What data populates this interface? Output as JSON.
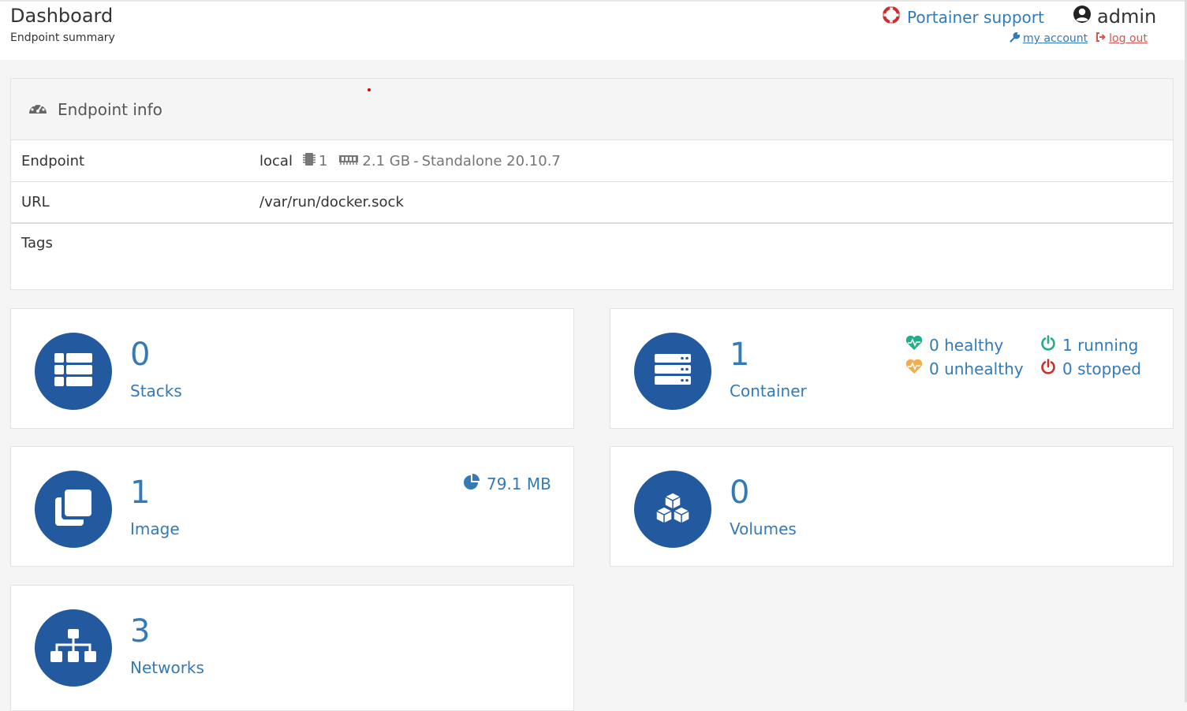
{
  "header": {
    "title": "Dashboard",
    "subtitle": "Endpoint summary",
    "support_label": "Portainer support",
    "username": "admin",
    "my_account": "my account",
    "log_out": "log out"
  },
  "endpoint_info": {
    "heading": "Endpoint info",
    "rows": [
      {
        "label": "Endpoint",
        "value": "local",
        "cpu": "1",
        "memory": "2.1 GB",
        "separator": "-",
        "mode": "Standalone 20.10.7"
      },
      {
        "label": "URL",
        "value": "/var/run/docker.sock"
      },
      {
        "label": "Tags",
        "value": ""
      }
    ]
  },
  "cards": {
    "stacks": {
      "count": "0",
      "label": "Stacks"
    },
    "containers": {
      "count": "1",
      "label": "Container",
      "healthy": "0 healthy",
      "unhealthy": "0 unhealthy",
      "running": "1 running",
      "stopped": "0 stopped"
    },
    "images": {
      "count": "1",
      "label": "Image",
      "size": "79.1 MB"
    },
    "volumes": {
      "count": "0",
      "label": "Volumes"
    },
    "networks": {
      "count": "3",
      "label": "Networks"
    }
  },
  "colors": {
    "accent": "#337ab7",
    "icon_circle": "#23599f",
    "healthy": "#23ae89",
    "unhealthy": "#f0ad4e",
    "stopped": "#c9302c",
    "danger": "#d9534f"
  },
  "icons": [
    "life-ring-icon",
    "user-circle-icon",
    "wrench-icon",
    "sign-out-icon",
    "tachometer-icon",
    "cpu-icon",
    "memory-icon",
    "th-list-icon",
    "server-icon",
    "clone-icon",
    "cubes-icon",
    "sitemap-icon",
    "heartbeat-icon",
    "power-off-icon",
    "pie-chart-icon"
  ]
}
